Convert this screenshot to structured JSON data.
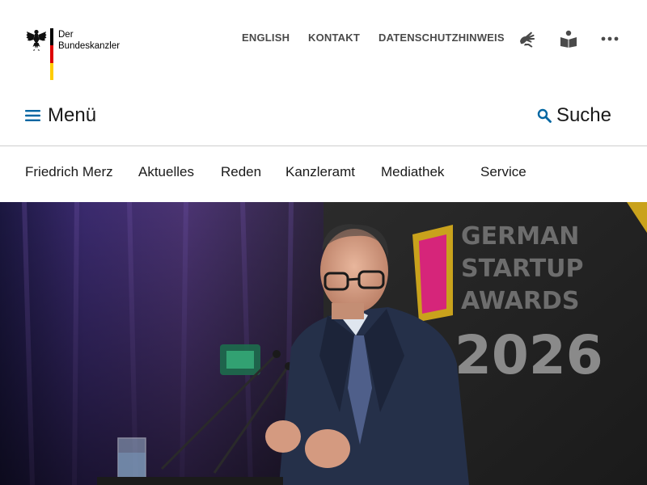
{
  "logo": {
    "line1": "Der",
    "line2": "Bundeskanzler",
    "emblem_icon": "federal-eagle-icon",
    "flag_colors": [
      "#000000",
      "#dd0000",
      "#ffcc00"
    ]
  },
  "top_links": {
    "english": "ENGLISH",
    "kontakt": "KONTAKT",
    "datenschutz": "DATENSCHUTZHINWEIS"
  },
  "top_icons": [
    "sign-language-icon",
    "easy-language-icon",
    "more-icon"
  ],
  "menu": {
    "label": "Menü",
    "icon": "hamburger-icon"
  },
  "search": {
    "label": "Suche",
    "icon": "search-icon"
  },
  "nav": {
    "items": [
      {
        "label": "Friedrich Merz"
      },
      {
        "label": "Aktuelles"
      },
      {
        "label": "Reden"
      },
      {
        "label": "Kanzleramt"
      },
      {
        "label": "Mediathek"
      },
      {
        "label": "Service"
      }
    ]
  },
  "hero": {
    "backdrop_text": [
      "GERMAN",
      "STARTUP",
      "AWARDS",
      "2026"
    ]
  },
  "colors": {
    "accent": "#0066a2",
    "text": "#1a1a1a",
    "muted_link": "#4a4a4a",
    "divider": "#cfcfcf"
  }
}
